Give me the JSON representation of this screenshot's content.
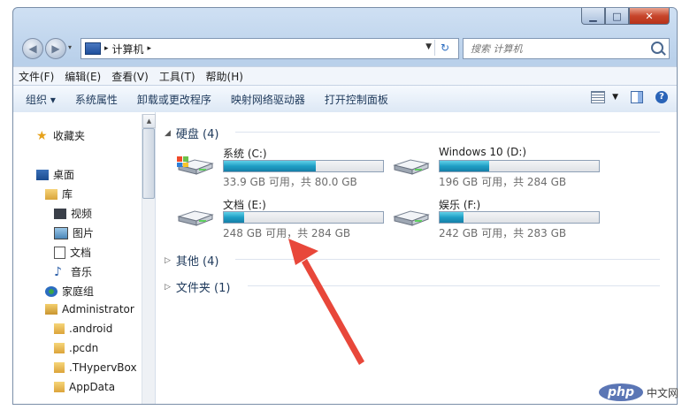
{
  "address": {
    "segment": "计算机",
    "search_placeholder": "搜索 计算机"
  },
  "menu": [
    "文件(F)",
    "编辑(E)",
    "查看(V)",
    "工具(T)",
    "帮助(H)"
  ],
  "toolbar": {
    "organize": "组织 ▾",
    "items": [
      "系统属性",
      "卸载或更改程序",
      "映射网络驱动器",
      "打开控制面板"
    ]
  },
  "nav": {
    "items": [
      "收藏夹",
      "桌面",
      "库",
      "视频",
      "图片",
      "文档",
      "音乐",
      "家庭组",
      "Administrator",
      ".android",
      ".pcdn",
      ".THypervBox",
      "AppData"
    ]
  },
  "groups": {
    "drives": "硬盘 (4)",
    "other": "其他 (4)",
    "folders": "文件夹 (1)"
  },
  "drives": [
    {
      "name": "系统 (C:)",
      "free": "33.9 GB 可用，共 80.0 GB",
      "used_fraction": 0.58,
      "system": true
    },
    {
      "name": "Windows 10 (D:)",
      "free": "196 GB 可用，共 284 GB",
      "used_fraction": 0.31,
      "system": false
    },
    {
      "name": "文档 (E:)",
      "free": "248 GB 可用，共 284 GB",
      "used_fraction": 0.13,
      "system": false
    },
    {
      "name": "娱乐 (F:)",
      "free": "242 GB 可用，共 283 GB",
      "used_fraction": 0.15,
      "system": false
    }
  ],
  "watermark": {
    "logo": "php",
    "text": "中文网"
  },
  "colors": {
    "accent": "#1f9fc5",
    "annotation_arrow": "#e8473a"
  }
}
